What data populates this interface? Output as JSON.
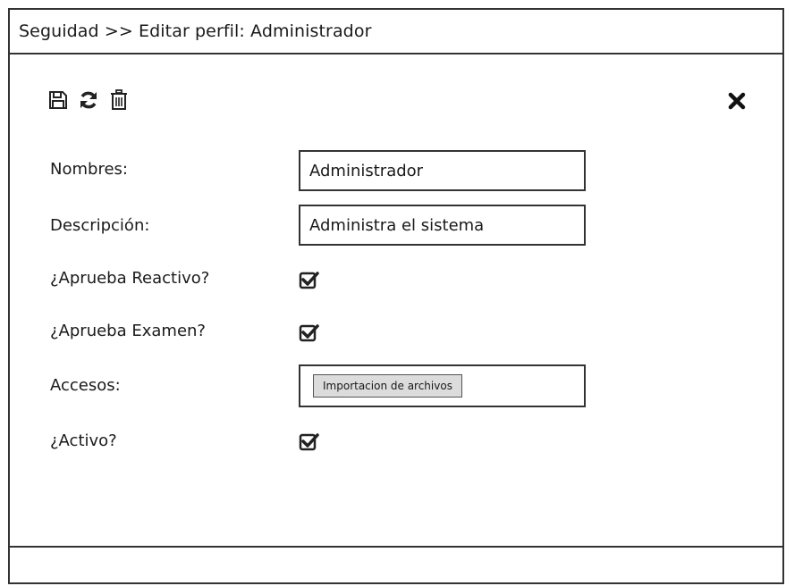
{
  "header": {
    "title": "Seguidad >> Editar perfil: Administrador"
  },
  "toolbar": {
    "save_icon": "save-icon",
    "refresh_icon": "refresh-icon",
    "delete_icon": "trash-icon",
    "close_icon": "close-icon"
  },
  "form": {
    "nombres_label": "Nombres:",
    "nombres_value": "Administrador",
    "descripcion_label": "Descripción:",
    "descripcion_value": "Administra el sistema",
    "aprueba_reactivo_label": "¿Aprueba Reactivo?",
    "aprueba_reactivo_checked": true,
    "aprueba_examen_label": "¿Aprueba Examen?",
    "aprueba_examen_checked": true,
    "accesos_label": "Accesos:",
    "accesos_items": [
      "Importacion de archivos"
    ],
    "activo_label": "¿Activo?",
    "activo_checked": true
  },
  "colors": {
    "border": "#333333",
    "chip_bg": "#dcdcdc"
  }
}
